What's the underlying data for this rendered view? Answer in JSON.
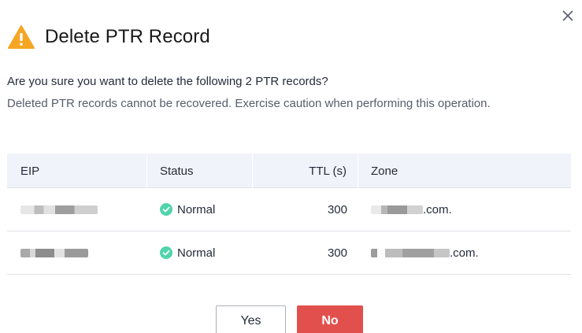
{
  "dialog": {
    "title": "Delete PTR Record",
    "message_primary": "Are you sure you want to delete the following 2 PTR records?",
    "message_secondary": "Deleted PTR records cannot be recovered. Exercise caution when performing this operation.",
    "close_icon": "close-icon",
    "title_icon": "warning-icon",
    "warning_color": "#f5a623"
  },
  "table": {
    "headers": {
      "eip": "EIP",
      "status": "Status",
      "ttl": "TTL (s)",
      "zone": "Zone"
    },
    "rows": [
      {
        "status": "Normal",
        "ttl": "300",
        "zone_suffix": ".com."
      },
      {
        "status": "Normal",
        "ttl": "300",
        "zone_suffix": ".com."
      }
    ],
    "status_color": "#50d4ab"
  },
  "buttons": {
    "yes_label": "Yes",
    "no_label": "No",
    "no_color": "#e2504d"
  }
}
